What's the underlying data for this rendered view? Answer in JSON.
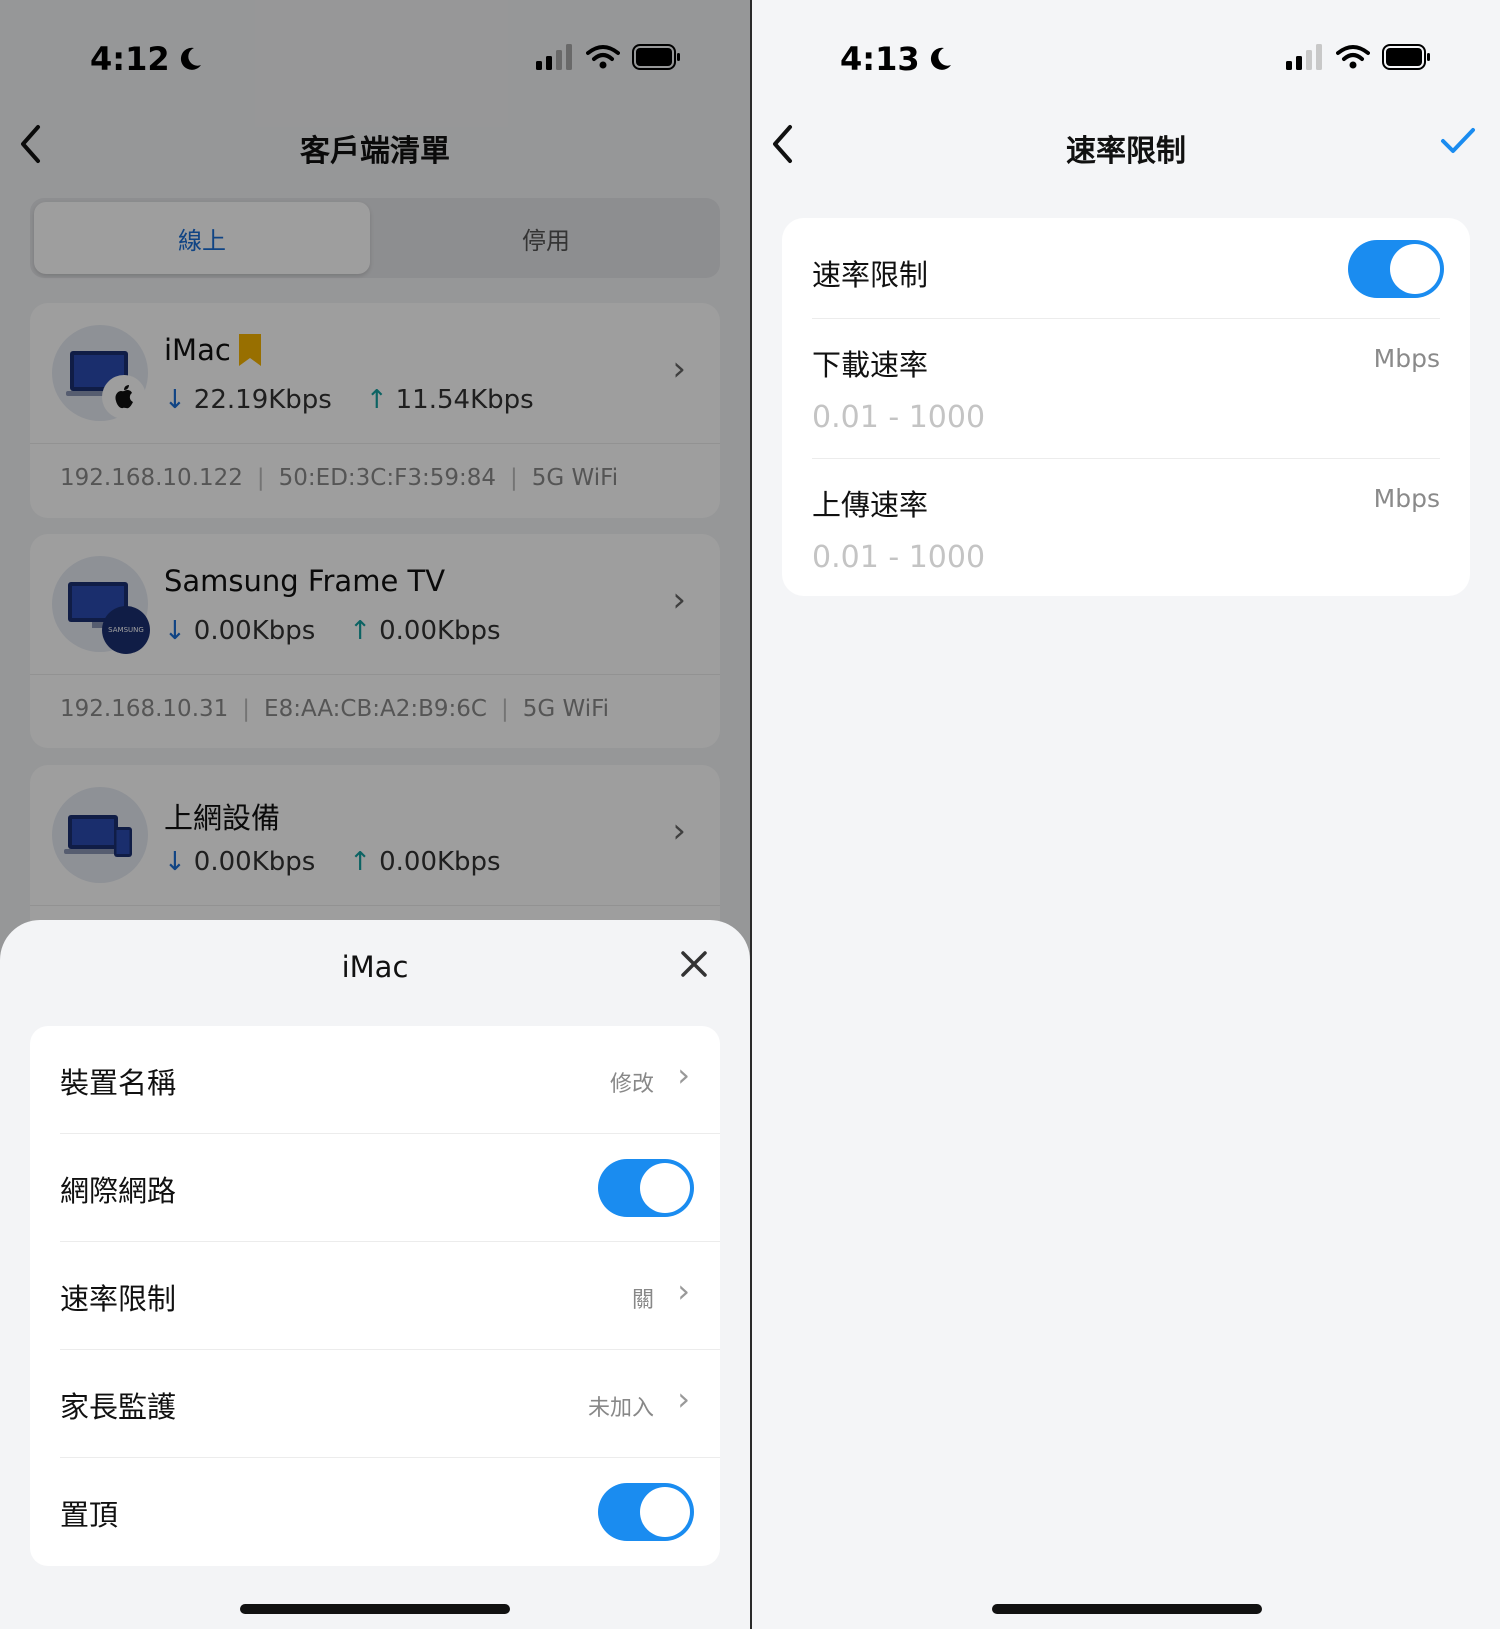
{
  "left": {
    "status": {
      "time": "4:12"
    },
    "nav": {
      "title": "客戶端清單"
    },
    "segments": {
      "active": "線上",
      "inactive": "停用"
    },
    "devices": [
      {
        "name": "iMac",
        "down": "22.19Kbps",
        "up": "11.54Kbps",
        "ip": "192.168.10.122",
        "mac": "50:ED:3C:F3:59:84",
        "band": "5G WiFi"
      },
      {
        "name": "Samsung Frame TV",
        "down": "0.00Kbps",
        "up": "0.00Kbps",
        "ip": "192.168.10.31",
        "mac": "E8:AA:CB:A2:B9:6C",
        "band": "5G WiFi"
      },
      {
        "name": "上網設備",
        "down": "0.00Kbps",
        "up": "0.00Kbps"
      }
    ],
    "samsung_logo_text": "SAMSUNG",
    "sheet": {
      "title": "iMac",
      "rows": [
        {
          "label": "裝置名稱",
          "value": "修改"
        },
        {
          "label": "網際網路",
          "toggle": true
        },
        {
          "label": "速率限制",
          "value": "關"
        },
        {
          "label": "家長監護",
          "value": "未加入"
        },
        {
          "label": "置頂",
          "toggle": true
        }
      ]
    }
  },
  "right": {
    "status": {
      "time": "4:13"
    },
    "nav": {
      "title": "速率限制"
    },
    "toggle_row": {
      "label": "速率限制",
      "on": true
    },
    "download": {
      "label": "下載速率",
      "unit": "Mbps",
      "placeholder": "0.01 - 1000"
    },
    "upload": {
      "label": "上傳速率",
      "unit": "Mbps",
      "placeholder": "0.01 - 1000"
    }
  },
  "colors": {
    "accent": "#1a8cf0",
    "bookmark": "#f5b400",
    "link": "#1a6fd6",
    "up_arrow": "#14a0a0"
  },
  "icons": [
    "back-chevron-icon",
    "moon-icon",
    "signal-icon",
    "wifi-icon",
    "battery-icon",
    "bookmark-icon",
    "apple-icon",
    "samsung-icon",
    "laptop-phone-icon",
    "chevron-right-icon",
    "close-icon",
    "check-icon"
  ]
}
